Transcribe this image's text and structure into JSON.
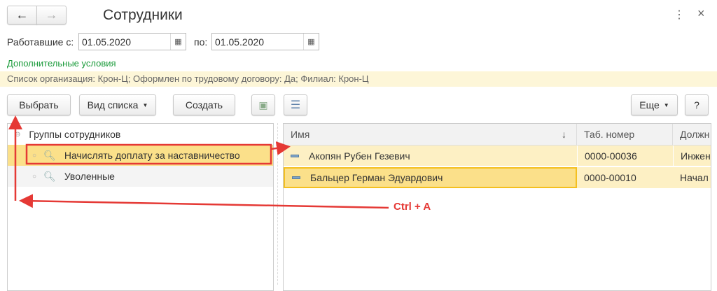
{
  "window": {
    "title": "Сотрудники",
    "back_icon": "←",
    "forward_icon": "→",
    "more_icon": "⋮",
    "close_icon": "×"
  },
  "filter": {
    "from_label": "Работавшие с:",
    "from_value": "01.05.2020",
    "to_label": "по:",
    "to_value": "01.05.2020"
  },
  "conditions": {
    "link": "Дополнительные условия",
    "summary": "Список организация: Крон-Ц; Оформлен по трудовому договору: Да; Филиал: Крон-Ц"
  },
  "toolbar": {
    "select": "Выбрать",
    "view": "Вид списка",
    "create": "Создать",
    "more": "Еще",
    "help": "?"
  },
  "groups": {
    "root": "Группы сотрудников",
    "items": [
      {
        "label": "Начислять доплату за наставничество"
      },
      {
        "label": "Уволенные"
      }
    ]
  },
  "table": {
    "columns": [
      "Имя",
      "Таб. номер",
      "Должн"
    ],
    "sort_icon": "↓",
    "rows": [
      {
        "name": "Акопян Рубен Гезевич",
        "num": "0000-00036",
        "pos": "Инжен"
      },
      {
        "name": "Бальцер Герман Эдуардович",
        "num": "0000-00010",
        "pos": "Начал"
      }
    ]
  },
  "annotation": {
    "text": "Ctrl + A",
    "color": "#e53935"
  }
}
